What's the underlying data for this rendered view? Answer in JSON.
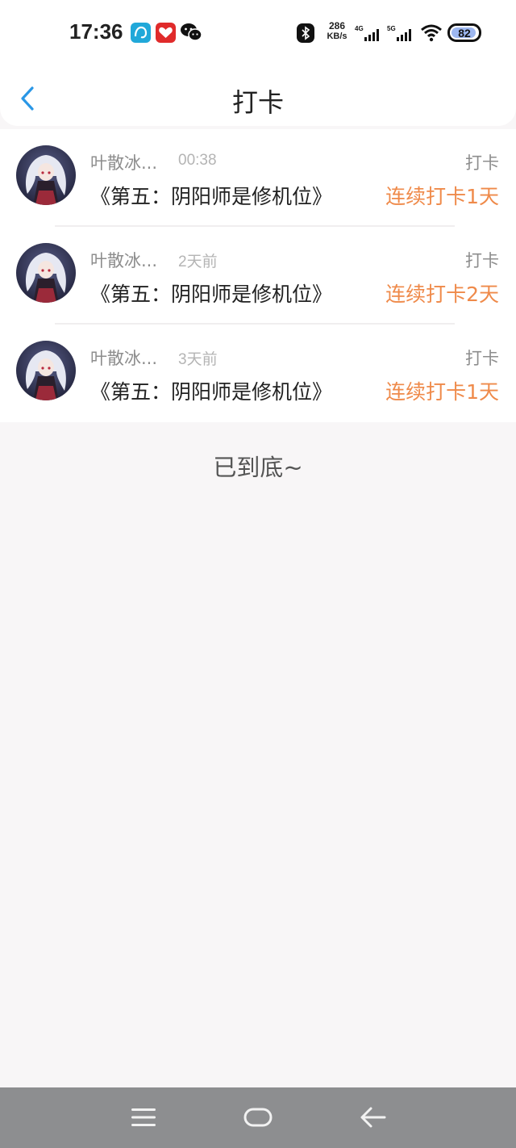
{
  "status_bar": {
    "time": "17:36",
    "net_speed_value": "286",
    "net_speed_unit": "KB/s",
    "signal_1_label": "4G",
    "signal_2_label": "5G",
    "battery_level": "82",
    "app_icons": [
      "meituan-icon",
      "pinduoduo-icon",
      "wechat-icon"
    ]
  },
  "header": {
    "title": "打卡",
    "back_icon": "chevron-left-icon",
    "accent_color": "#2a97e6"
  },
  "checkins": [
    {
      "nickname": "叶散冰...",
      "time": "00:38",
      "type": "打卡",
      "content": "《第五：阴阳师是修机位》",
      "streak": "连续打卡1天"
    },
    {
      "nickname": "叶散冰...",
      "time": "2天前",
      "type": "打卡",
      "content": "《第五：阴阳师是修机位》",
      "streak": "连续打卡2天"
    },
    {
      "nickname": "叶散冰...",
      "time": "3天前",
      "type": "打卡",
      "content": "《第五：阴阳师是修机位》",
      "streak": "连续打卡1天"
    }
  ],
  "footer": {
    "end_text": "已到底~"
  },
  "colors": {
    "streak": "#ef8a4a",
    "page_bg": "#f8f6f7"
  },
  "system_nav": [
    "menu-icon",
    "home-icon",
    "back-arrow-icon"
  ]
}
